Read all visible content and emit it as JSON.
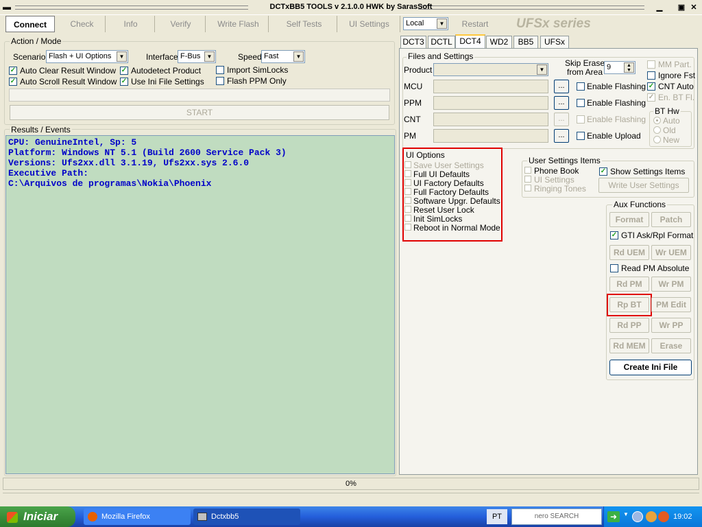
{
  "window": {
    "title": "DCTxBB5 TOOLS v 2.1.0.0 HWK by SarasSoft",
    "min": "▁",
    "max": "▣",
    "close": "✕",
    "sysmenu": "▬"
  },
  "toolbar": {
    "buttons": [
      "Connect",
      "Check",
      "Info",
      "Verify",
      "Write Flash",
      "Self Tests",
      "UI Settings"
    ],
    "mode_value": "Local",
    "restart": "Restart",
    "brand": "UFSx  series"
  },
  "action": {
    "title": "Action / Mode",
    "scenario_label": "Scenario",
    "scenario_value": "Flash + UI Options",
    "interface_label": "Interface",
    "interface_value": "F-Bus",
    "speed_label": "Speed",
    "speed_value": "Fast",
    "checks": [
      {
        "label": "Auto Clear Result Window",
        "checked": true
      },
      {
        "label": "Autodetect Product",
        "checked": true
      },
      {
        "label": "Import SimLocks",
        "checked": false
      },
      {
        "label": "Auto Scroll Result Window",
        "checked": true
      },
      {
        "label": "Use Ini File Settings",
        "checked": true
      },
      {
        "label": "Flash PPM Only",
        "checked": false
      }
    ],
    "start": "START"
  },
  "results": {
    "title": "Results / Events",
    "lines": [
      "CPU: GenuineIntel, Sp: 5",
      "Platform: Windows NT 5.1 (Build 2600 Service Pack 3)",
      "Versions: Ufs2xx.dll 3.1.19, Ufs2xx.sys 2.6.0",
      "Executive Path:",
      "C:\\Arquivos de programas\\Nokia\\Phoenix"
    ]
  },
  "tabs": [
    "DCT3",
    "DCTL",
    "DCT4",
    "WD2",
    "BB5",
    "UFSx"
  ],
  "files": {
    "title": "Files and Settings",
    "product_label": "Product",
    "skip_erase_label_1": "Skip Erase",
    "skip_erase_label_2": "from Area",
    "skip_erase_value": "9",
    "rows": [
      {
        "label": "MCU",
        "dots": "...",
        "enable": "Enable Flashing"
      },
      {
        "label": "PPM",
        "dots": "...",
        "enable": "Enable Flashing"
      },
      {
        "label": "CNT",
        "dots": "...",
        "enable": "Enable Flashing"
      },
      {
        "label": "PM",
        "dots": "...",
        "enable": "Enable Upload"
      }
    ],
    "right_checks": [
      {
        "label": "MM Part.",
        "checked": false
      },
      {
        "label": "Ignore Fst",
        "checked": false
      },
      {
        "label": "CNT Auto",
        "checked": true
      },
      {
        "label": "En. BT Fl.",
        "checked": true
      }
    ],
    "bt_hw": {
      "title": "BT Hw",
      "options": [
        "Auto",
        "Old",
        "New"
      ]
    }
  },
  "ui_options": {
    "title": "UI Options",
    "items": [
      "Save User Settings",
      "Full UI Defaults",
      "UI Factory Defaults",
      "Full Factory Defaults",
      "Software Upgr. Defaults",
      "Reset User Lock",
      "Init SimLocks",
      "Reboot in Normal Mode"
    ]
  },
  "user_settings": {
    "title": "User Settings Items",
    "items": [
      "Phone Book",
      "UI Settings",
      "Ringing Tones"
    ],
    "show_label": "Show Settings Items",
    "write_btn": "Write User Settings"
  },
  "aux": {
    "title": "Aux Functions",
    "row1": [
      "Format",
      "Patch"
    ],
    "gti_label": "GTI Ask/Rpl Format",
    "row2": [
      "Rd UEM",
      "Wr UEM"
    ],
    "read_pm_label": "Read PM Absolute",
    "row3": [
      "Rd PM",
      "Wr PM"
    ],
    "row4": [
      "Rp BT",
      "PM Edit"
    ],
    "row5": [
      "Rd PP",
      "Wr PP"
    ],
    "row6": [
      "Rd MEM",
      "Erase"
    ],
    "create_btn": "Create Ini File"
  },
  "status": {
    "progress": "0%"
  },
  "taskbar": {
    "start": "Iniciar",
    "tasks": [
      "Mozilla Firefox",
      "Dctxbb5"
    ],
    "lang": "PT",
    "nero": "nero SEARCH",
    "clock": "19:02"
  }
}
